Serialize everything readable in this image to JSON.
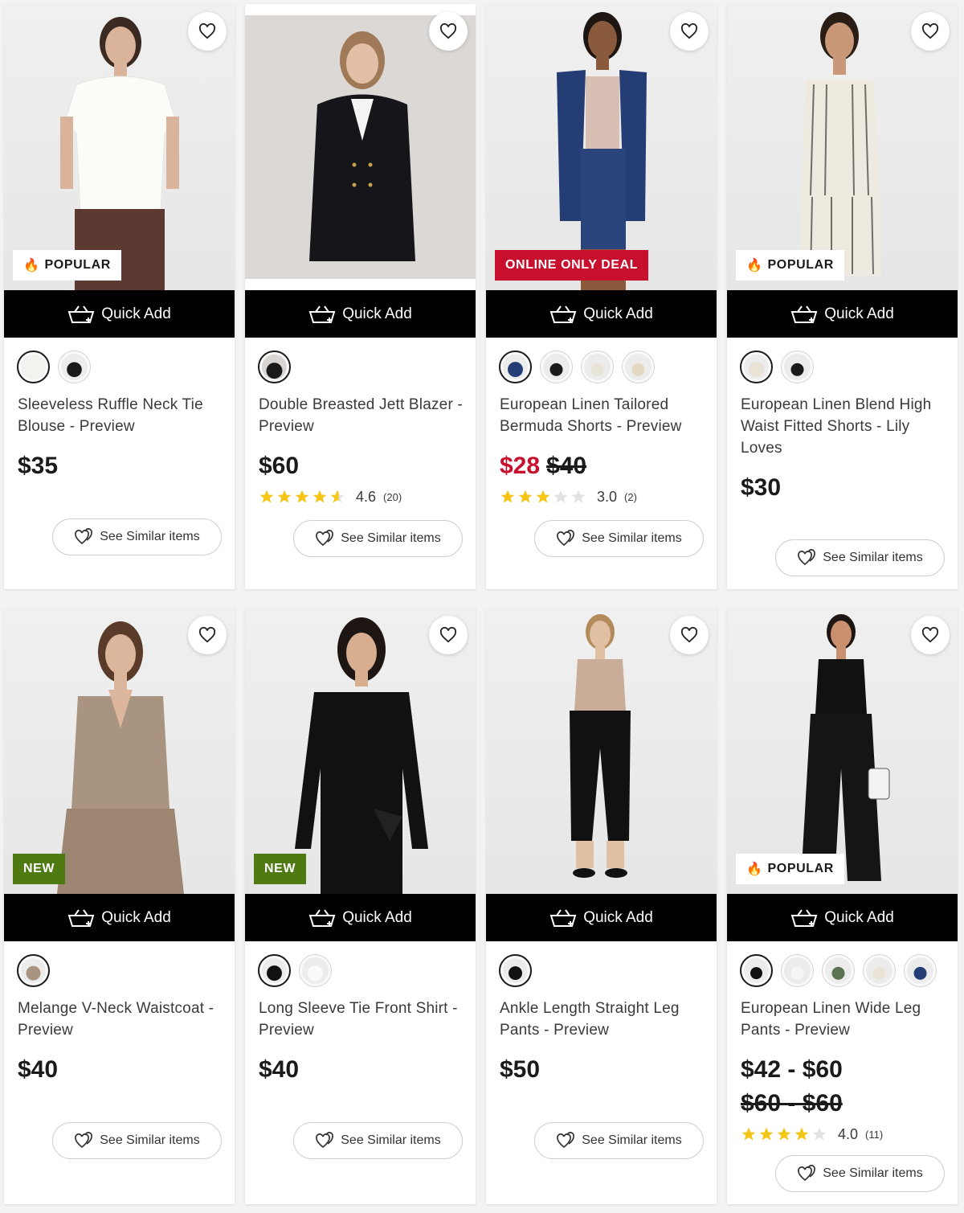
{
  "labels": {
    "quick_add": "Quick Add",
    "see_similar": "See Similar items"
  },
  "colors": {
    "sale_red": "#c8102e",
    "new_green": "#4f7a12",
    "star_gold": "#f5c518"
  },
  "products": [
    {
      "name": "Sleeveless Ruffle Neck Tie Blouse - Preview",
      "badge": "POPULAR",
      "badge_type": "popular",
      "swatch_count": 2,
      "price": "$35",
      "sale": null,
      "was": null,
      "was_line": null,
      "rating": null,
      "rating_count": null
    },
    {
      "name": "Double Breasted Jett Blazer - Preview",
      "badge": null,
      "badge_type": null,
      "swatch_count": 1,
      "price": "$60",
      "sale": null,
      "was": null,
      "was_line": null,
      "rating": "4.6",
      "rating_count": "(20)",
      "stars": 4.6
    },
    {
      "name": "European Linen Tailored Bermuda Shorts - Preview",
      "badge": "ONLINE ONLY DEAL",
      "badge_type": "deal",
      "swatch_count": 4,
      "price": null,
      "sale": "$28",
      "was": "$40",
      "was_line": null,
      "rating": "3.0",
      "rating_count": "(2)",
      "stars": 3.0
    },
    {
      "name": "European Linen Blend High Waist Fitted Shorts - Lily Loves",
      "badge": "POPULAR",
      "badge_type": "popular",
      "swatch_count": 2,
      "price": "$30",
      "sale": null,
      "was": null,
      "was_line": null,
      "rating": null,
      "rating_count": null
    },
    {
      "name": "Melange V-Neck Waistcoat - Preview",
      "badge": "NEW",
      "badge_type": "new",
      "swatch_count": 1,
      "price": "$40",
      "sale": null,
      "was": null,
      "was_line": null,
      "rating": null,
      "rating_count": null
    },
    {
      "name": "Long Sleeve Tie Front Shirt - Preview",
      "badge": "NEW",
      "badge_type": "new",
      "swatch_count": 2,
      "price": "$40",
      "sale": null,
      "was": null,
      "was_line": null,
      "rating": null,
      "rating_count": null
    },
    {
      "name": "Ankle Length Straight Leg Pants - Preview",
      "badge": null,
      "badge_type": null,
      "swatch_count": 1,
      "price": "$50",
      "sale": null,
      "was": null,
      "was_line": null,
      "rating": null,
      "rating_count": null
    },
    {
      "name": "European Linen Wide Leg Pants - Preview",
      "badge": "POPULAR",
      "badge_type": "popular",
      "swatch_count": 5,
      "price": "$42 - $60",
      "sale": null,
      "was": null,
      "was_line": "$60 - $60",
      "rating": "4.0",
      "rating_count": "(11)",
      "stars": 4.0
    }
  ]
}
